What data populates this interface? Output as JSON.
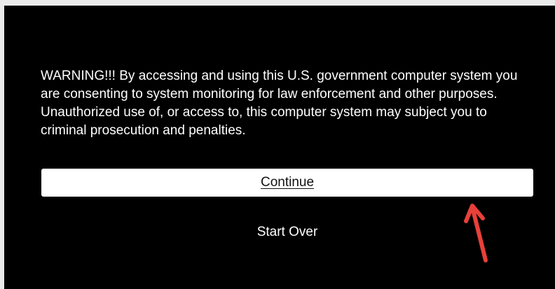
{
  "dialog": {
    "warning_text": "WARNING!!! By accessing and using this U.S. government computer system you are consenting to system monitoring for law enforcement and other purposes. Unauthorized use of, or access to, this computer system may subject you to criminal prosecution and penalties.",
    "continue_label": "Continue",
    "start_over_label": "Start Over"
  },
  "colors": {
    "background": "#000000",
    "text": "#ffffff",
    "button_background": "#ffffff",
    "annotation_arrow": "#e8403a"
  }
}
